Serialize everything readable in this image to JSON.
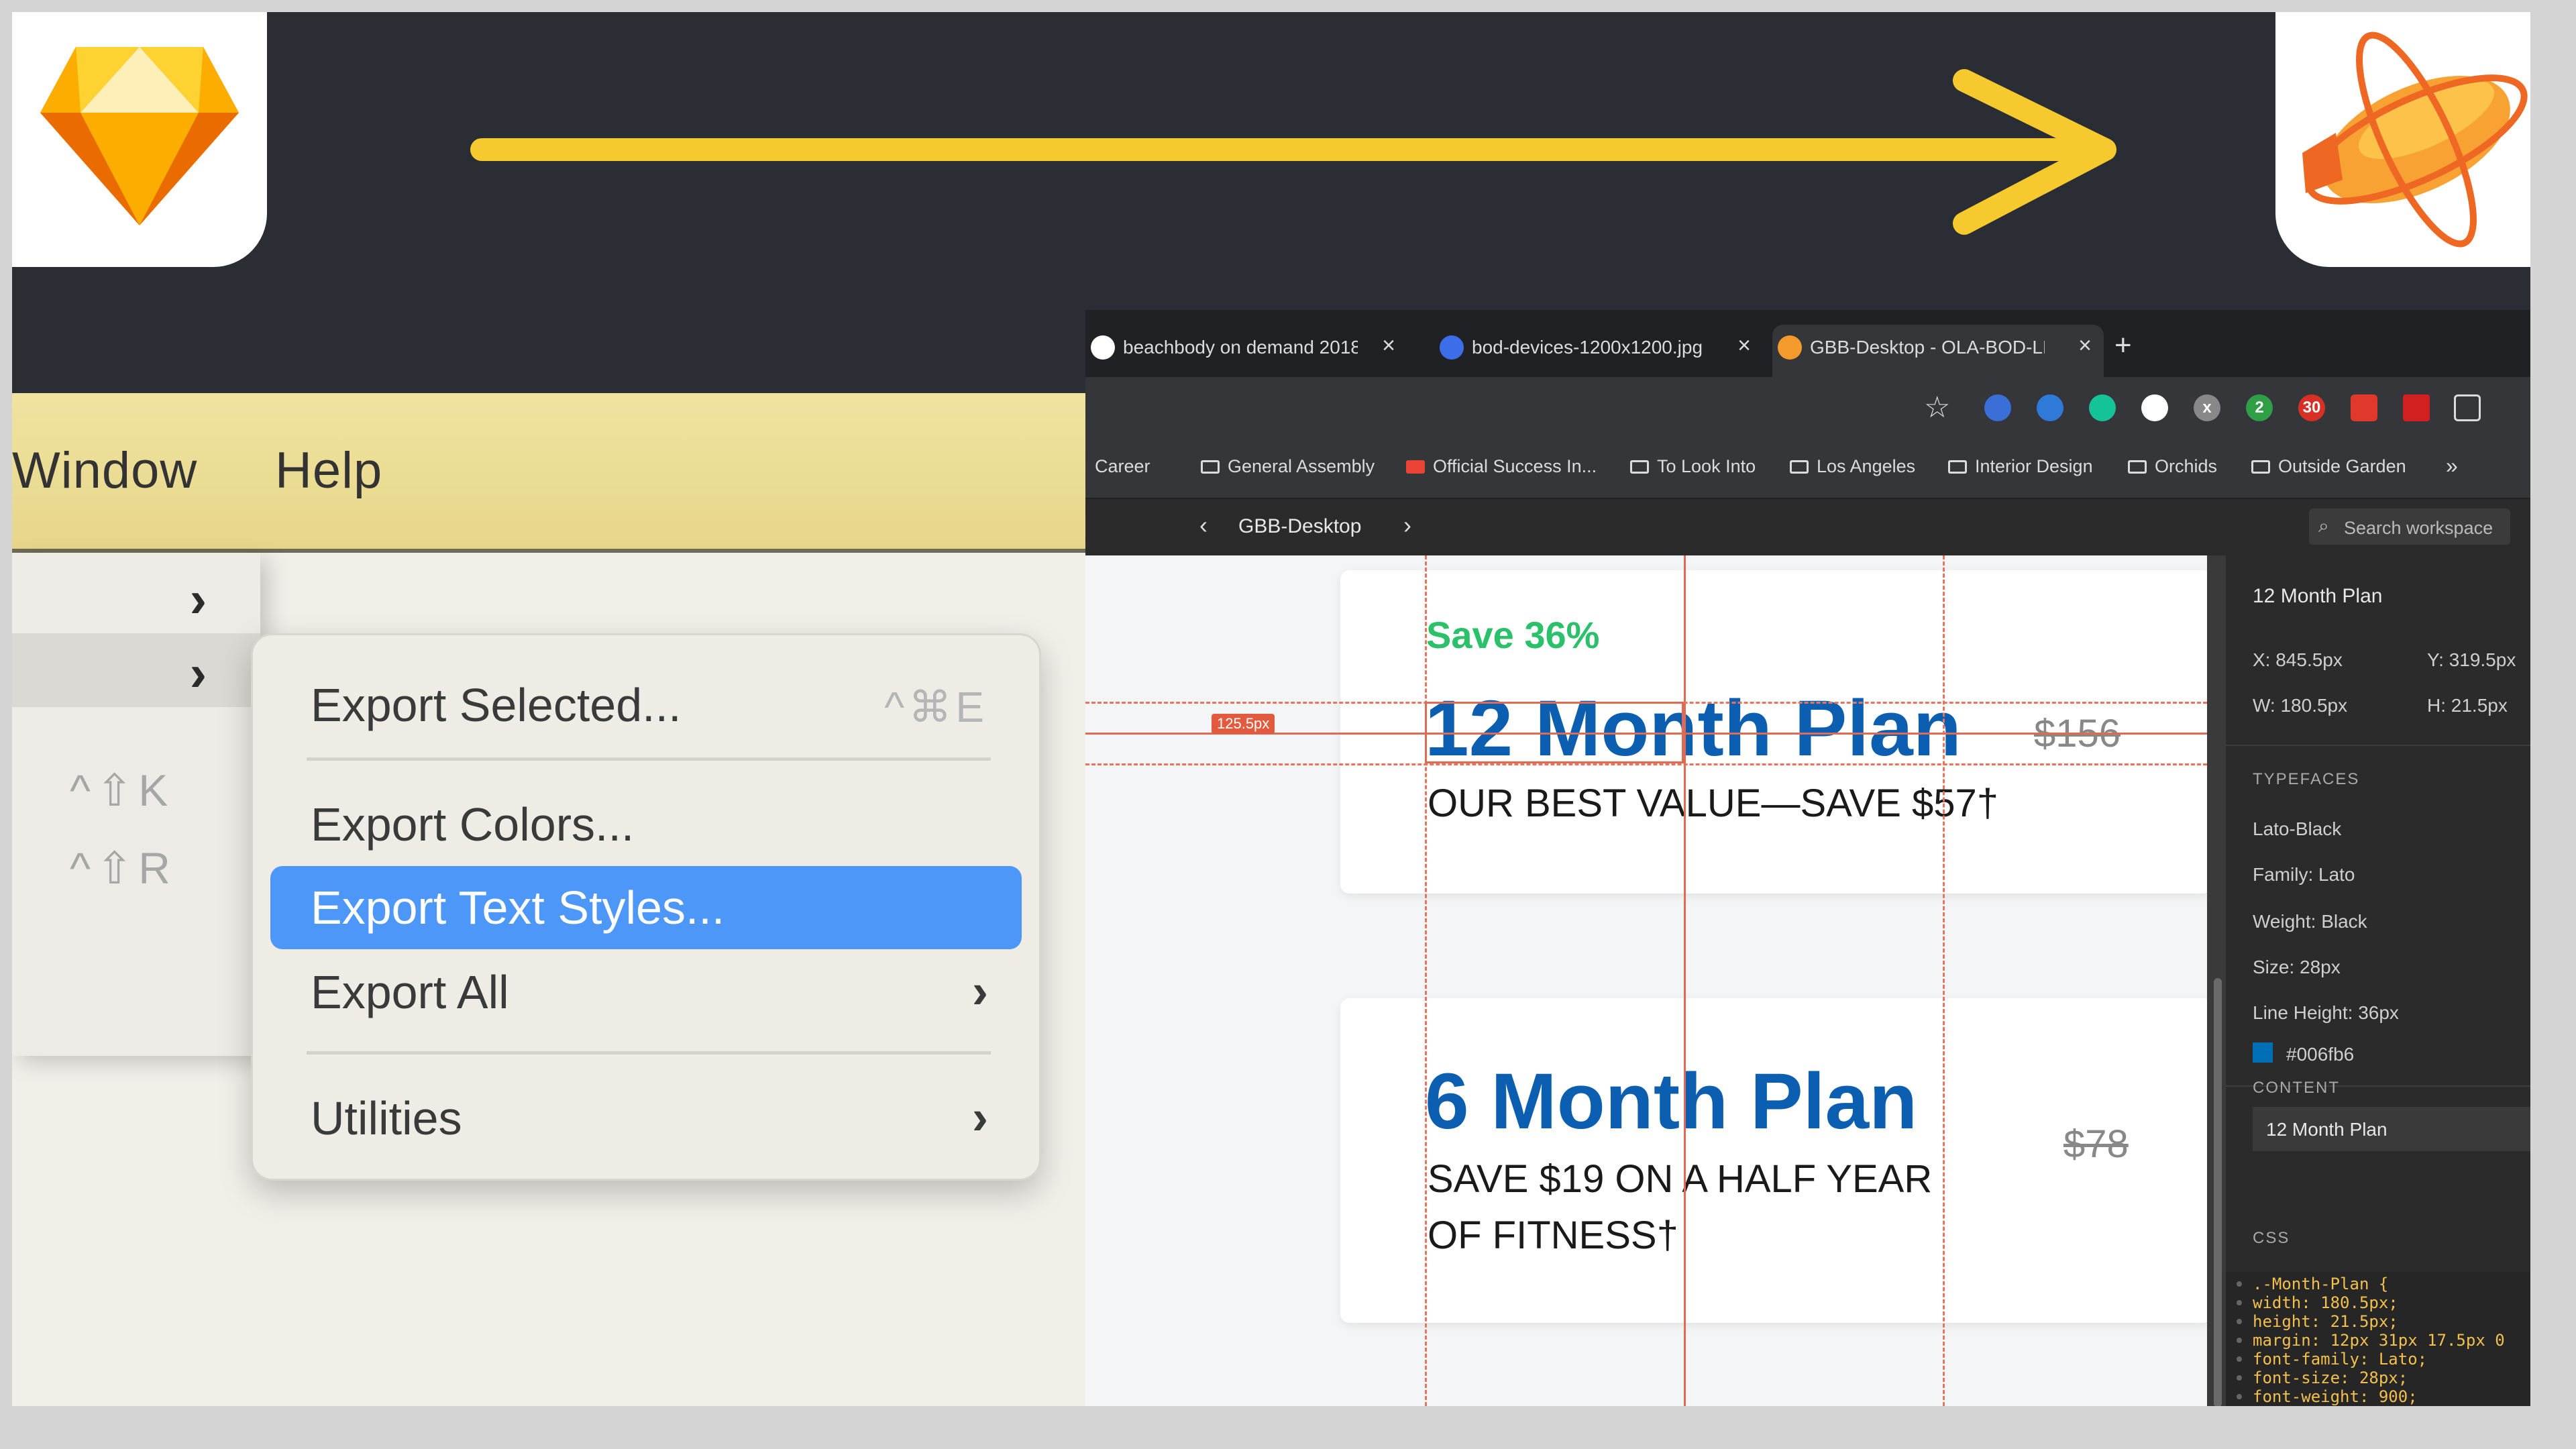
{
  "sketch_menu": {
    "menubar": [
      "Window",
      "Help"
    ],
    "shortcuts": [
      "^⇧K",
      "^⇧R"
    ],
    "submenu": [
      {
        "label": "Export Selected...",
        "shortcut": "^⌘E"
      },
      {
        "label": "Export Colors...",
        "shortcut": ""
      },
      {
        "label": "Export Text Styles...",
        "shortcut": "",
        "highlighted": true
      },
      {
        "label": "Export All",
        "shortcut": ""
      },
      {
        "label": "Utilities",
        "shortcut": ""
      }
    ]
  },
  "browser": {
    "tabs": [
      {
        "title": "beachbody on demand 2018 -"
      },
      {
        "title": "bod-devices-1200x1200.jpg"
      },
      {
        "title": "GBB-Desktop - OLA-BOD-LP"
      }
    ],
    "bookmarks": [
      "Career",
      "General Assembly",
      "Official Success In...",
      "To Look Into",
      "Los Angeles",
      "Interior Design",
      "Orchids",
      "Outside Garden"
    ],
    "extension_badges": [
      "x",
      "2",
      "30"
    ]
  },
  "zeplin": {
    "breadcrumb": "GBB-Desktop",
    "search_placeholder": "Search workspace",
    "cards": [
      {
        "save": "Save 36%",
        "plan": "12 Month Plan",
        "sub": "OUR BEST VALUE—SAVE $57†",
        "old_price": "$156"
      },
      {
        "plan": "6 Month Plan",
        "sub_lines": [
          "SAVE $19 ON A HALF YEAR",
          "OF FITNESS†"
        ],
        "old_price": "$78"
      }
    ],
    "measure": "125.5px",
    "inspector": {
      "title": "12 Month Plan",
      "x": "X: 845.5px",
      "y": "Y: 319.5px",
      "w": "W: 180.5px",
      "h": "H: 21.5px",
      "typefaces_heading": "TYPEFACES",
      "typeface": "Lato-Black",
      "family": "Family: Lato",
      "weight": "Weight: Black",
      "size": "Size: 28px",
      "line_height": "Line Height: 36px",
      "color_hex": "#006fb6",
      "content_heading": "CONTENT",
      "content": "12 Month Plan",
      "css_heading": "CSS",
      "css_lines": [
        ".-Month-Plan {",
        "  width: 180.5px;",
        "  height: 21.5px;",
        "  margin: 12px 31px 17.5px 0",
        "  font-family: Lato;",
        "  font-size: 28px;",
        "  font-weight: 900;"
      ]
    }
  },
  "colors": {
    "frame": "#2a2d34",
    "arrow": "#f6c92e",
    "menu_highlight": "#4d97f8",
    "plan_blue": "#0c5fb0",
    "save_green": "#2bc06a"
  }
}
